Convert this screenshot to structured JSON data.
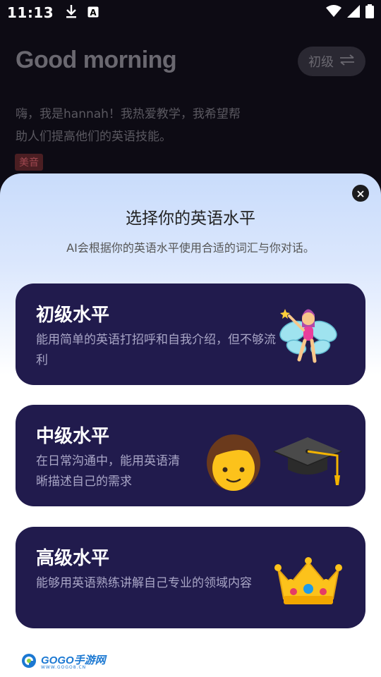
{
  "status_bar": {
    "time": "11:13",
    "icons": [
      "download-icon",
      "font-a-icon",
      "wifi-icon",
      "signal-icon",
      "battery-icon"
    ]
  },
  "background": {
    "greeting": "Good morning",
    "level_switch_label": "初级",
    "intro": "嗨，我是hannah！我热爱教学，我希望帮助人们提高他们的英语技能。",
    "accent_tag": "美音"
  },
  "sheet": {
    "title": "选择你的英语水平",
    "subtitle": "AI会根据你的英语水平使用合适的词汇与你对话。",
    "levels": [
      {
        "title": "初级水平",
        "desc": "能用简单的英语打招呼和自我介绍，但不够流利",
        "icon": "fairy-icon"
      },
      {
        "title": "中级水平",
        "desc": "在日常沟通中，能用英语清晰描述自己的需求",
        "icon": "boy-and-graduation-cap-icon"
      },
      {
        "title": "高级水平",
        "desc": "能够用英语熟练讲解自己专业的领域内容",
        "icon": "crown-icon"
      }
    ]
  },
  "watermark": {
    "logo_text": "GOGO手游网",
    "domain_text": "WWW.GOGO8.CN"
  },
  "colors": {
    "card_bg": "#211b4d",
    "sheet_top": "#c9dcfb",
    "page_bg": "#0d0b14",
    "accent_tag_bg": "#4a1e22"
  }
}
